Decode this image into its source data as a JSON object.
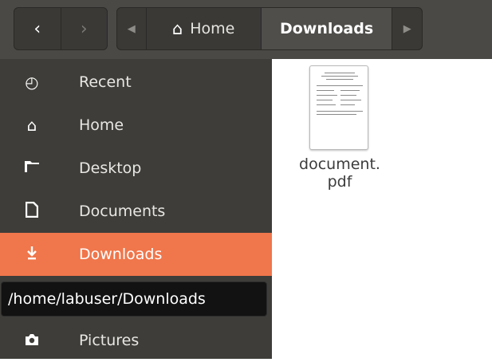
{
  "header": {
    "back_icon": "chevron-left",
    "forward_icon": "chevron-right",
    "path_scroll_left_icon": "triangle-left",
    "path_scroll_right_icon": "triangle-right",
    "path": [
      {
        "label": "Home",
        "icon": "home-icon"
      },
      {
        "label": "Downloads",
        "current": true
      }
    ]
  },
  "sidebar": {
    "items": [
      {
        "label": "Recent",
        "icon": "clock-icon"
      },
      {
        "label": "Home",
        "icon": "home-icon"
      },
      {
        "label": "Desktop",
        "icon": "folder-icon"
      },
      {
        "label": "Documents",
        "icon": "document-icon"
      },
      {
        "label": "Downloads",
        "icon": "download-icon",
        "active": true
      },
      {
        "label": "",
        "icon": "music-icon"
      },
      {
        "label": "Pictures",
        "icon": "camera-icon"
      }
    ],
    "tooltip": "/home/labuser/Downloads"
  },
  "files": [
    {
      "name_line1": "document.",
      "name_line2": "pdf",
      "type": "pdf"
    }
  ],
  "colors": {
    "header_bg": "#4a4945",
    "sidebar_bg": "#3e3d39",
    "accent": "#f0764b",
    "tooltip_bg": "#121212"
  }
}
